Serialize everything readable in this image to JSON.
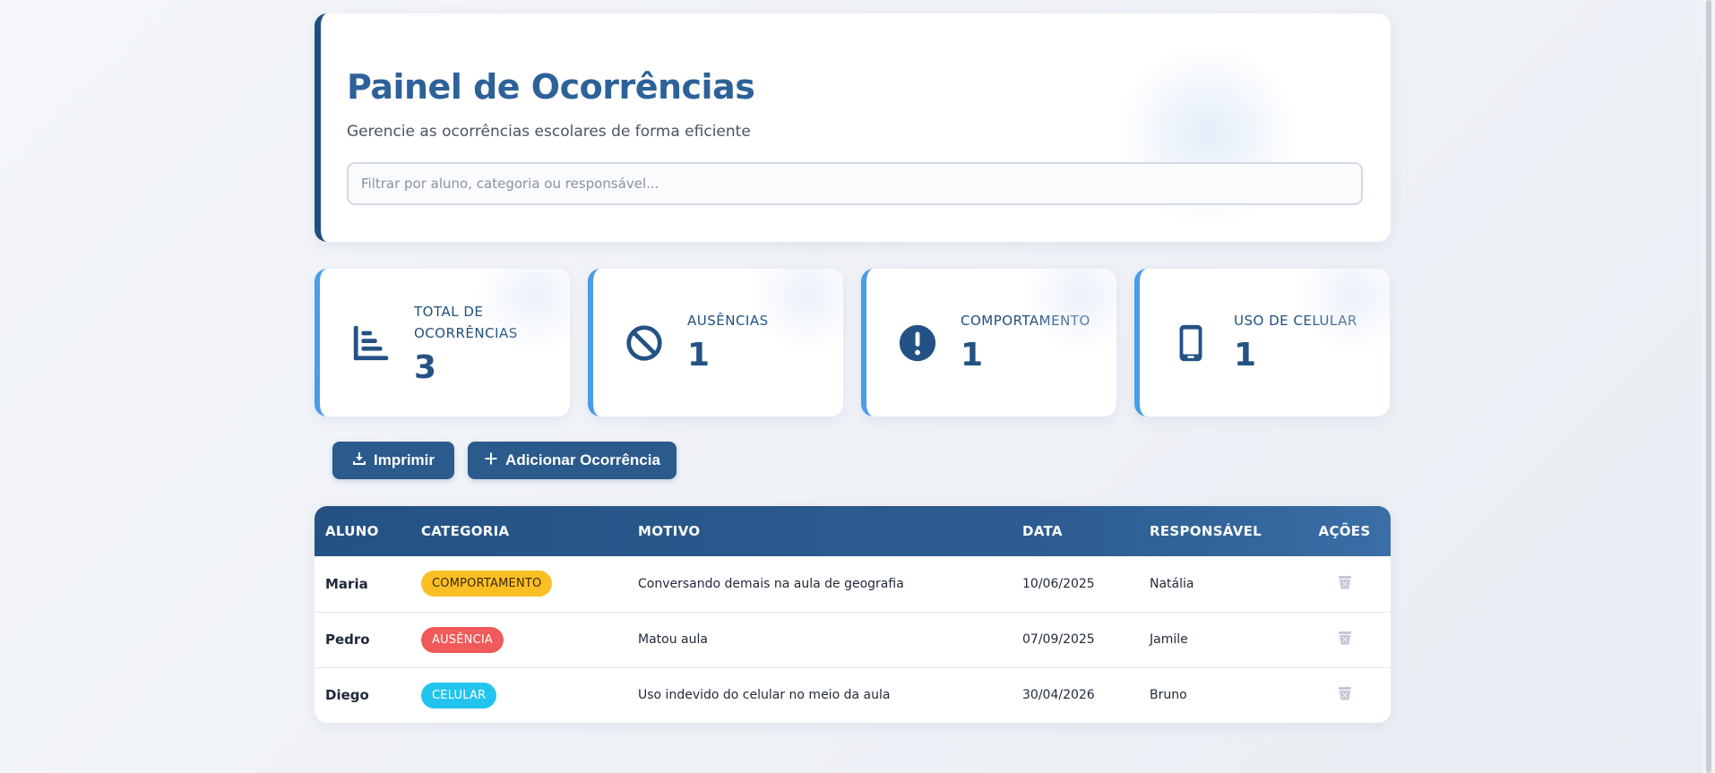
{
  "header": {
    "title": "Painel de Ocorrências",
    "subtitle": "Gerencie as ocorrências escolares de forma eficiente",
    "search_placeholder": "Filtrar por aluno, categoria ou responsável..."
  },
  "stats": [
    {
      "label": "Total de ocorrências",
      "value": "3",
      "icon": "bar-chart-icon"
    },
    {
      "label": "Ausências",
      "value": "1",
      "icon": "ban-icon"
    },
    {
      "label": "Comportamento",
      "value": "1",
      "icon": "exclamation-circle-icon"
    },
    {
      "label": "Uso de celular",
      "value": "1",
      "icon": "mobile-phone-icon"
    }
  ],
  "actions": {
    "print_label": "Imprimir",
    "add_label": "Adicionar Ocorrência"
  },
  "table": {
    "columns": [
      "ALUNO",
      "CATEGORIA",
      "MOTIVO",
      "DATA",
      "RESPONSÁVEL",
      "AÇÕES"
    ],
    "rows": [
      {
        "aluno": "Maria",
        "categoria": "COMPORTAMENTO",
        "motivo": "Conversando demais na aula de geografia",
        "data": "10/06/2025",
        "responsavel": "Natália"
      },
      {
        "aluno": "Pedro",
        "categoria": "AUSÊNCIA",
        "motivo": "Matou aula",
        "data": "07/09/2025",
        "responsavel": "Jamile"
      },
      {
        "aluno": "Diego",
        "categoria": "CELULAR",
        "motivo": "Uso indevido do celular no meio da aula",
        "data": "30/04/2026",
        "responsavel": "Bruno"
      }
    ]
  },
  "colors": {
    "primary": "#245284",
    "accent": "#4a9de6",
    "badge_comportamento": "#fbbf24",
    "badge_ausencia": "#f05a5a",
    "badge_celular": "#22c4ee"
  }
}
